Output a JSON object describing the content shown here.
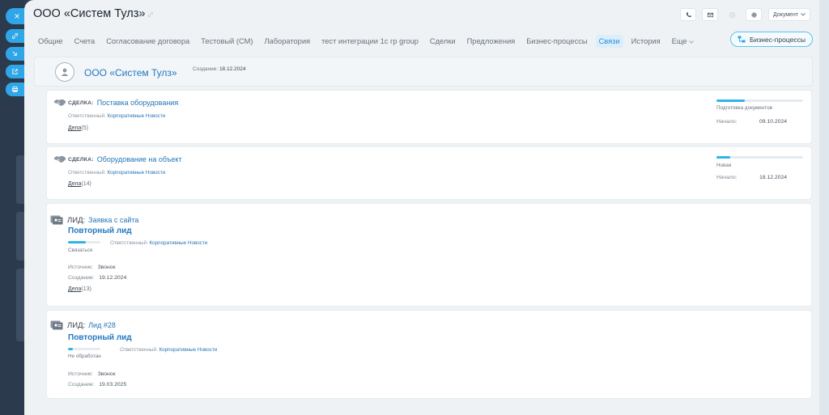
{
  "window": {
    "title": "ООО «Систем Тулз»"
  },
  "side_actions": [
    {
      "icon": "close-icon",
      "label": "×"
    },
    {
      "icon": "link-icon"
    },
    {
      "icon": "minimize-icon"
    },
    {
      "icon": "external-window-icon"
    },
    {
      "icon": "print-icon"
    }
  ],
  "header": {
    "document_label": "Документ",
    "bp_button": "Бизнес-процессы"
  },
  "tabs": [
    {
      "label": "Общие",
      "active": false
    },
    {
      "label": "Счета",
      "active": false
    },
    {
      "label": "Согласование договора",
      "active": false
    },
    {
      "label": "Тестовый (СМ)",
      "active": false
    },
    {
      "label": "Лаборатория",
      "active": false
    },
    {
      "label": "тест интеграции 1с гр group",
      "active": false
    },
    {
      "label": "Сделки",
      "active": false
    },
    {
      "label": "Предложения",
      "active": false
    },
    {
      "label": "Бизнес-процессы",
      "active": false
    },
    {
      "label": "Связи",
      "active": true
    },
    {
      "label": "История",
      "active": false
    },
    {
      "label": "Еще",
      "active": false
    }
  ],
  "company": {
    "name": "ООО «Систем Тулз»",
    "created_label": "Создание:",
    "created_value": "18.12.2024"
  },
  "deals": [
    {
      "type": "СДЕЛКА:",
      "title": "Поставка оборудования",
      "resp_label": "Ответственный:",
      "resp_value": "Корпоративные Новости",
      "dela_label": "Дела",
      "dela_count": "(5)",
      "stage": "Подготовка документов",
      "progress": 0.33,
      "start_label": "Начало:",
      "start_value": "09.10.2024"
    },
    {
      "type": "СДЕЛКА:",
      "title": "Оборудование на объект",
      "resp_label": "Ответственный:",
      "resp_value": "Корпоративные Новости",
      "dela_label": "Дела",
      "dela_count": "(14)",
      "stage": "Новая",
      "progress": 0.16,
      "start_label": "Начало:",
      "start_value": "18.12.2024"
    }
  ],
  "leads": [
    {
      "type": "ЛИД:",
      "title": "Заявка с сайта",
      "subtitle": "Повторный лид",
      "stage": "Связаться",
      "progress": 0.55,
      "resp_label": "Ответственный:",
      "resp_value": "Корпоративные Новости",
      "source_label": "Источник:",
      "source_value": "Звонок",
      "created_label": "Создание:",
      "created_value": "19.12.2024",
      "dela_label": "Дела",
      "dela_count": "(13)"
    },
    {
      "type": "ЛИД:",
      "title": "Лид #28",
      "subtitle": "Повторный лид",
      "stage": "Не обработан",
      "progress": 0.15,
      "resp_label": "Ответственный:",
      "resp_value": "Корпоративные Новости",
      "source_label": "Источник:",
      "source_value": "Звонок",
      "created_label": "Создание:",
      "created_value": "19.03.2025"
    }
  ],
  "colors": {
    "accent": "#2fa6e8",
    "link": "#2278c0",
    "progress": "#2fb4e6",
    "active_tab_bg": "#dceefb"
  }
}
